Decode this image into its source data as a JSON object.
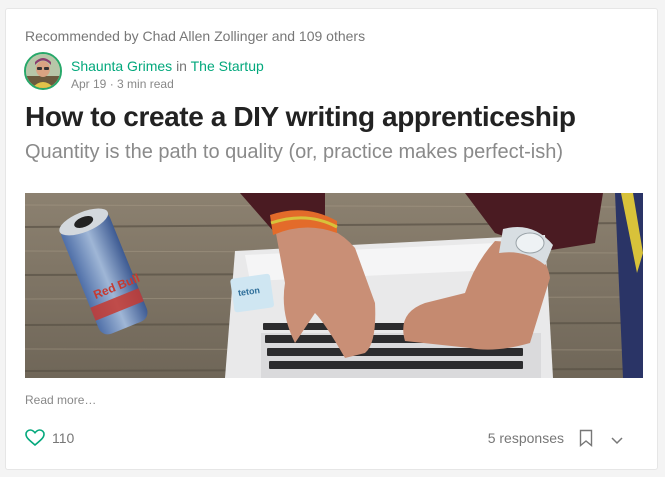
{
  "post": {
    "recommended_by": "Recommended by Chad Allen Zollinger and 109 others",
    "author": "Shaunta Grimes",
    "in_word": "in",
    "publication": "The Startup",
    "date": "Apr 19",
    "read_time": "3 min read",
    "title": "How to create a DIY writing apprenticeship",
    "subtitle": "Quantity is the path to quality (or, practice makes perfect-ish)",
    "read_more": "Read more…",
    "claps": "110",
    "responses": "5 responses",
    "image_text": {
      "can_brand": "Red Bull",
      "sticker": "teton"
    }
  },
  "colors": {
    "accent_green": "#03a87c",
    "text_muted": "#777777",
    "title_text": "#222222"
  },
  "icons": [
    "heart-icon",
    "bookmark-icon",
    "chevron-down-icon"
  ]
}
